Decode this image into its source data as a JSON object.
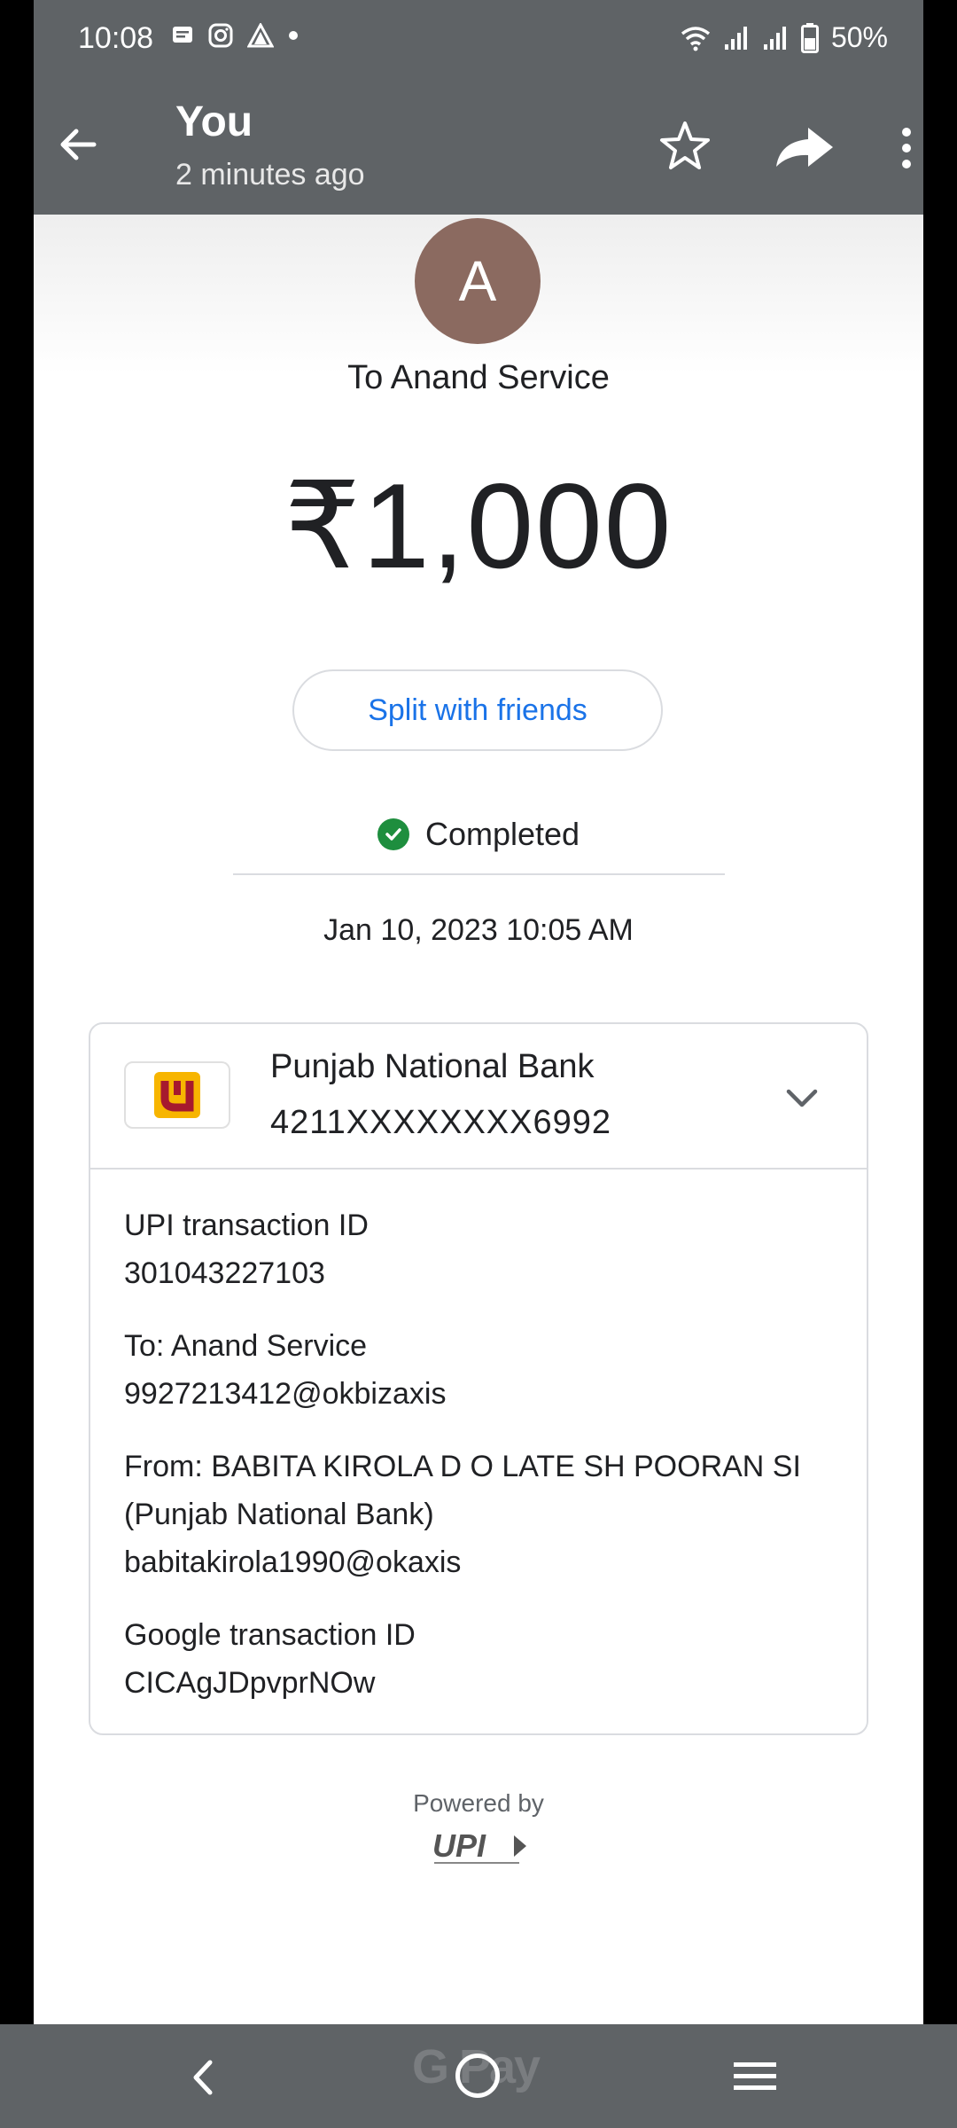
{
  "status_bar": {
    "time": "10:08",
    "battery": "50%",
    "left_icons": [
      "message-icon",
      "instagram-icon",
      "app-icon",
      "dot-icon"
    ],
    "right_icons": [
      "wifi-icon",
      "signal-icon",
      "signal-icon",
      "battery-icon"
    ]
  },
  "appbar": {
    "title": "You",
    "subtitle": "2 minutes ago",
    "icons": [
      "back-arrow-icon",
      "star-icon",
      "share-icon",
      "more-vert-icon"
    ]
  },
  "payee": {
    "avatar_letter": "A",
    "to_label": "To Anand Service"
  },
  "amount": "₹1,000",
  "split_button": "Split with friends",
  "status": {
    "text": "Completed",
    "color": "#1e8e3e"
  },
  "datetime": "Jan 10, 2023 10:05 AM",
  "bank": {
    "name": "Punjab National Bank",
    "account": "4211XXXXXXXX6992"
  },
  "details": {
    "upi_label": "UPI transaction ID",
    "upi_value": "301043227103",
    "to_label": "To: Anand Service",
    "to_value": "9927213412@okbizaxis",
    "from_label": "From: BABITA KIROLA D O LATE SH POORAN SI (Punjab National Bank)",
    "from_value": "babitakirola1990@okaxis",
    "google_label": "Google transaction ID",
    "google_value": "CICAgJDpvprNOw"
  },
  "footer": {
    "powered_by": "Powered by",
    "upi_logo": "UPI"
  },
  "navbar": {
    "app_watermark": "G Pay"
  },
  "colors": {
    "accent": "#1a73e8",
    "overlay": "#5f6366",
    "avatar": "#8b6a60"
  }
}
